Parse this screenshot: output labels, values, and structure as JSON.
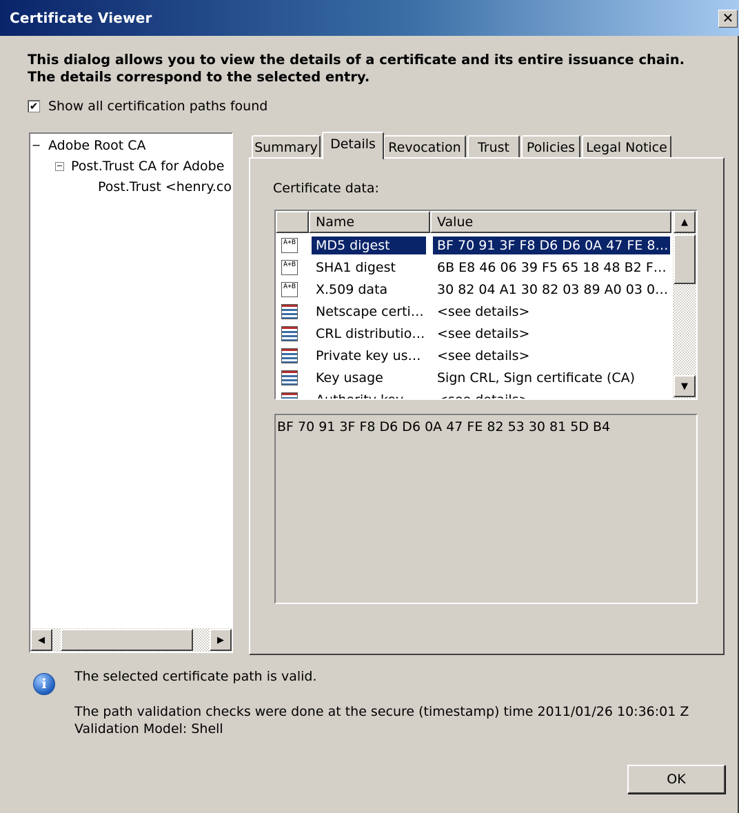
{
  "window": {
    "title": "Certificate Viewer",
    "close_label": "✕"
  },
  "intro": "This dialog allows you to view the details of a certificate and its entire issuance chain. The details correspond to the selected entry.",
  "show_paths": {
    "label": "Show all certification paths found",
    "checked": true,
    "mark": "✔"
  },
  "tree": {
    "nodes": [
      {
        "label": "Adobe Root CA",
        "expander": "−"
      },
      {
        "label": "Post.Trust CA for Adobe",
        "expander": "−"
      },
      {
        "label": "Post.Trust <henry.co",
        "expander": ""
      }
    ],
    "scroll_left": "◀",
    "scroll_right": "▶"
  },
  "tabs": [
    "Summary",
    "Details",
    "Revocation",
    "Trust",
    "Policies",
    "Legal Notice"
  ],
  "active_tab": "Details",
  "certificate_data_label": "Certificate data:",
  "list": {
    "headers": [
      "Name",
      "Value"
    ],
    "rows": [
      {
        "icon": "hash-icon",
        "name": "MD5 digest",
        "value": "BF 70 91 3F F8 D6 D6 0A 47 FE 8…",
        "selected": true
      },
      {
        "icon": "hash-icon",
        "name": "SHA1 digest",
        "value": "6B E8 46 06 39 F5 65 18 48 B2 F…"
      },
      {
        "icon": "hash-icon",
        "name": "X.509 data",
        "value": "30 82 04 A1 30 82 03 89 A0 03 0…"
      },
      {
        "icon": "extension-icon",
        "name": "Netscape certi…",
        "value": "<see details>"
      },
      {
        "icon": "extension-icon",
        "name": "CRL distributio…",
        "value": "<see details>"
      },
      {
        "icon": "extension-icon",
        "name": "Private key us…",
        "value": "<see details>"
      },
      {
        "icon": "extension-icon",
        "name": "Key usage",
        "value": "Sign CRL, Sign certificate (CA)"
      },
      {
        "icon": "extension-icon",
        "name": "Authority key…",
        "value": "<see details>"
      }
    ],
    "hash_icon_text": "A+B",
    "scroll_up": "▲",
    "scroll_down": "▼"
  },
  "detail_value": "BF 70 91 3F F8 D6 D6 0A 47 FE 82 53 30 81 5D B4",
  "status": {
    "icon_glyph": "i",
    "valid_text": "The selected certificate path is valid.",
    "validation_line1": "The path validation checks were done at the secure (timestamp) time 2011/01/26 10:36:01 Z",
    "validation_line2": "Validation Model: Shell"
  },
  "ok_label": "OK",
  "colors": {
    "selection": "#0a246a",
    "dialog_bg": "#d4d0c8",
    "title_start": "#0a246a",
    "title_end": "#a6caf0"
  }
}
